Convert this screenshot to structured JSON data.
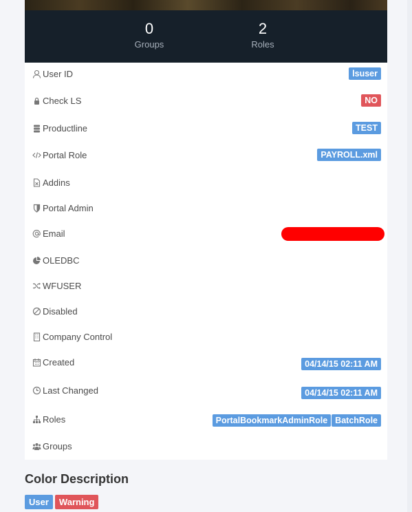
{
  "stats": {
    "groups": {
      "value": "0",
      "label": "Groups"
    },
    "roles": {
      "value": "2",
      "label": "Roles"
    }
  },
  "rows": [
    {
      "label": "User ID",
      "icon": "user-icon",
      "badges": [
        "lsuser"
      ]
    },
    {
      "label": "Check LS",
      "icon": "lock-icon",
      "badges": [
        "NO"
      ]
    },
    {
      "label": "Productline",
      "icon": "database-icon",
      "badges": [
        "TEST"
      ]
    },
    {
      "label": "Portal Role",
      "icon": "code-icon",
      "badges": [
        "PAYROLL.xml"
      ]
    },
    {
      "label": "Addins",
      "icon": "file-icon",
      "badges": []
    },
    {
      "label": "Portal Admin",
      "icon": "shield-icon",
      "badges": []
    },
    {
      "label": "Email",
      "icon": "at-icon",
      "badges": []
    },
    {
      "label": "OLEDBC",
      "icon": "pie-chart-icon",
      "badges": []
    },
    {
      "label": "WFUSER",
      "icon": "shuffle-icon",
      "badges": []
    },
    {
      "label": "Disabled",
      "icon": "ban-icon",
      "badges": []
    },
    {
      "label": "Company Control",
      "icon": "building-icon",
      "badges": []
    },
    {
      "label": "Created",
      "icon": "calendar-icon",
      "badges": [
        "04/14/15 02:11 AM"
      ]
    },
    {
      "label": "Last Changed",
      "icon": "clock-icon",
      "badges": [
        "04/14/15 02:11 AM"
      ]
    },
    {
      "label": "Roles",
      "icon": "sitemap-icon",
      "badges": [
        "PortalBookmarkAdminRole",
        "BatchRole"
      ]
    },
    {
      "label": "Groups",
      "icon": "users-icon",
      "badges": []
    }
  ],
  "colors": {
    "info": "#5b9be0",
    "danger": "#e0555a",
    "dark": "#16202a"
  },
  "color_description": {
    "title": "Color Description",
    "items": [
      "User",
      "Warning"
    ]
  }
}
